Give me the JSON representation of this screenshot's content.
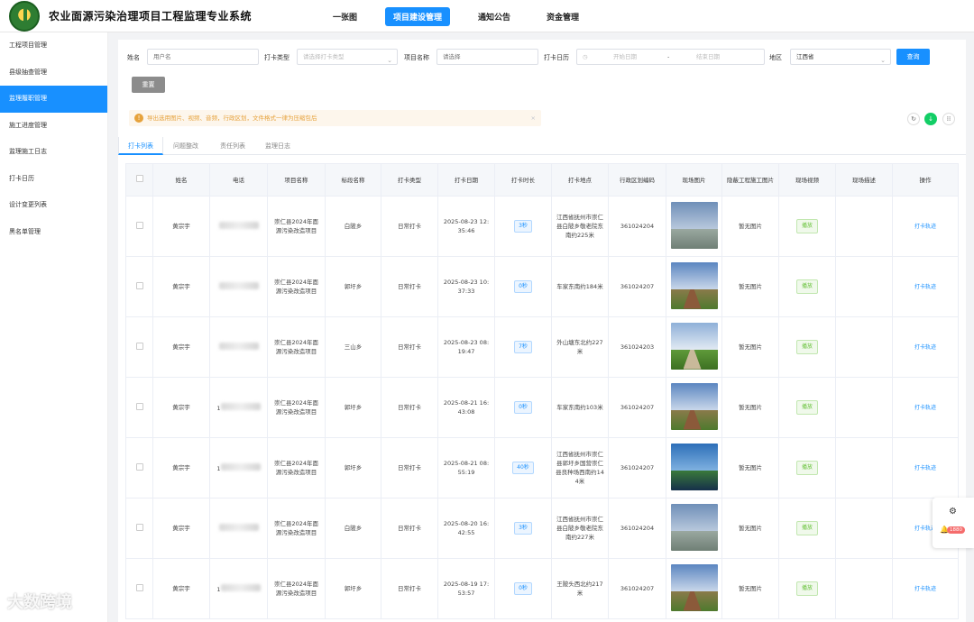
{
  "header": {
    "title": "农业面源污染治理项目工程监理专业系统",
    "nav": [
      "一张图",
      "项目建设管理",
      "通知公告",
      "资金管理"
    ],
    "active_nav": 1
  },
  "sidebar": {
    "items": [
      {
        "label": "工程项目管理"
      },
      {
        "label": "县级抽查管理"
      },
      {
        "label": "监理履职管理"
      },
      {
        "label": "施工进度管理"
      },
      {
        "label": "监理施工日志"
      },
      {
        "label": "打卡日历"
      },
      {
        "label": "设计变更列表"
      },
      {
        "label": "黑名单管理"
      }
    ],
    "active_index": 2
  },
  "filters": {
    "name_label": "姓名",
    "name_placeholder": "用户名",
    "type_label": "打卡类型",
    "type_placeholder": "请选择打卡类型",
    "project_label": "项目名称",
    "project_placeholder": "请选择",
    "date_label": "打卡日历",
    "date_start_placeholder": "开始日期",
    "date_sep": "-",
    "date_end_placeholder": "结束日期",
    "region_label": "地区",
    "region_value": "江西省",
    "search_btn": "查询",
    "reset_btn": "重置"
  },
  "notice": {
    "text": "导出选用图片、视频、音频，行政区划，文件格式一律为压缩包后",
    "close": "×"
  },
  "toolbar_icons": [
    "refresh-icon",
    "download-icon",
    "columns-icon"
  ],
  "tabs": [
    "打卡列表",
    "问题整改",
    "责任列表",
    "监理日志"
  ],
  "active_tab": 0,
  "table": {
    "columns": [
      "",
      "姓名",
      "电话",
      "项目名称",
      "标段名称",
      "打卡类型",
      "打卡日期",
      "打卡时长",
      "打卡地点",
      "行政区划编码",
      "现场图片",
      "隐蔽工程施工图片",
      "现场视频",
      "现场描述",
      "操作"
    ],
    "rows": [
      {
        "name": "黄宗宇",
        "phone_prefix": "",
        "project": "崇仁县2024年面源污染改造项目",
        "section": "白陂乡",
        "type": "日常打卡",
        "date": "2025-08-23 12:35:46",
        "duration": "3秒",
        "location": "江西省抚州市崇仁县白陂乡敬老院东南约225米",
        "code": "361024204",
        "hidden": "暂无图片",
        "video": "播放",
        "desc": "",
        "action": "打卡轨迹",
        "scene": "fence"
      },
      {
        "name": "黄宗宇",
        "phone_prefix": "",
        "project": "崇仁县2024年面源污染改造项目",
        "section": "郭圩乡",
        "type": "日常打卡",
        "date": "2025-08-23 10:37:33",
        "duration": "0秒",
        "location": "车家东南约184米",
        "code": "361024207",
        "hidden": "暂无图片",
        "video": "播放",
        "desc": "",
        "action": "打卡轨迹",
        "scene": "field"
      },
      {
        "name": "黄宗宇",
        "phone_prefix": "",
        "project": "崇仁县2024年面源污染改造项目",
        "section": "三山乡",
        "type": "日常打卡",
        "date": "2025-08-23 08:19:47",
        "duration": "7秒",
        "location": "外山塘东北约227米",
        "code": "361024203",
        "hidden": "暂无图片",
        "video": "播放",
        "desc": "",
        "action": "打卡轨迹",
        "scene": "road"
      },
      {
        "name": "黄宗宇",
        "phone_prefix": "1",
        "project": "崇仁县2024年面源污染改造项目",
        "section": "郭圩乡",
        "type": "日常打卡",
        "date": "2025-08-21 16:43:08",
        "duration": "0秒",
        "location": "车家东南约103米",
        "code": "361024207",
        "hidden": "暂无图片",
        "video": "播放",
        "desc": "",
        "action": "打卡轨迹",
        "scene": "field"
      },
      {
        "name": "黄宗宇",
        "phone_prefix": "1",
        "project": "崇仁县2024年面源污染改造项目",
        "section": "郭圩乡",
        "type": "日常打卡",
        "date": "2025-08-21 08:55:19",
        "duration": "40秒",
        "location": "江西省抚州市崇仁县郭圩乡国营崇仁县良种场西南约144米",
        "code": "361024207",
        "hidden": "暂无图片",
        "video": "播放",
        "desc": "",
        "action": "打卡轨迹",
        "scene": "water"
      },
      {
        "name": "黄宗宇",
        "phone_prefix": "",
        "project": "崇仁县2024年面源污染改造项目",
        "section": "白陂乡",
        "type": "日常打卡",
        "date": "2025-08-20 16:42:55",
        "duration": "3秒",
        "location": "江西省抚州市崇仁县白陂乡敬老院东南约227米",
        "code": "361024204",
        "hidden": "暂无图片",
        "video": "播放",
        "desc": "",
        "action": "打卡轨迹",
        "scene": "fence"
      },
      {
        "name": "黄宗宇",
        "phone_prefix": "1",
        "project": "崇仁县2024年面源污染改造项目",
        "section": "郭圩乡",
        "type": "日常打卡",
        "date": "2025-08-19 17:53:57",
        "duration": "0秒",
        "location": "王陂头西北约217米",
        "code": "361024207",
        "hidden": "暂无图片",
        "video": "播放",
        "desc": "",
        "action": "打卡轨迹",
        "scene": "field"
      }
    ]
  },
  "float_panel": {
    "badge": "1880"
  },
  "watermark": "大数跨境",
  "colors": {
    "accent": "#1890ff",
    "success": "#13ce66",
    "warning": "#e6a23c"
  }
}
